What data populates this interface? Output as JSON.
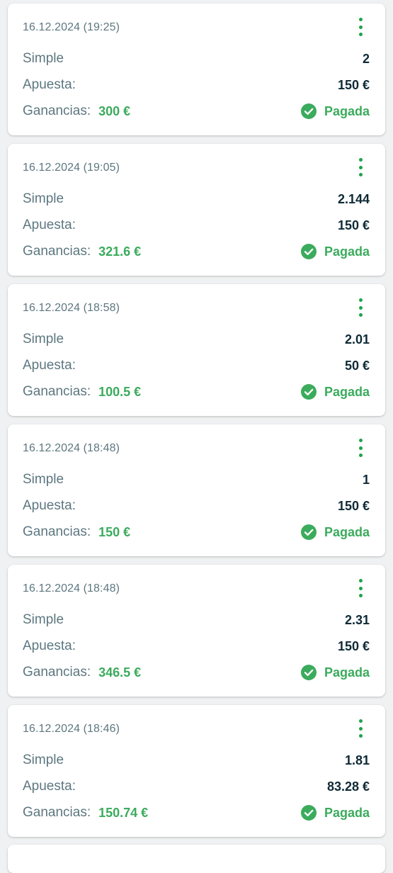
{
  "labels": {
    "type": "Simple",
    "stake": "Apuesta:",
    "winnings": "Ganancias:"
  },
  "colors": {
    "background": "#eff1f2",
    "card": "#ffffff",
    "label": "#5d7780",
    "value": "#0e2a36",
    "accent_green": "#1fa24a",
    "winnings_green": "#3bab5c"
  },
  "icons": {
    "menu": "more-vertical-icon",
    "status": "check-circle-icon"
  },
  "bets": [
    {
      "date": "16.12.2024 (19:25)",
      "odds": "2",
      "stake": "150 €",
      "winnings": "300 €",
      "status": "Pagada"
    },
    {
      "date": "16.12.2024 (19:05)",
      "odds": "2.144",
      "stake": "150 €",
      "winnings": "321.6 €",
      "status": "Pagada"
    },
    {
      "date": "16.12.2024 (18:58)",
      "odds": "2.01",
      "stake": "50 €",
      "winnings": "100.5 €",
      "status": "Pagada"
    },
    {
      "date": "16.12.2024 (18:48)",
      "odds": "1",
      "stake": "150 €",
      "winnings": "150 €",
      "status": "Pagada"
    },
    {
      "date": "16.12.2024 (18:48)",
      "odds": "2.31",
      "stake": "150 €",
      "winnings": "346.5 €",
      "status": "Pagada"
    },
    {
      "date": "16.12.2024 (18:46)",
      "odds": "1.81",
      "stake": "83.28 €",
      "winnings": "150.74 €",
      "status": "Pagada"
    }
  ]
}
